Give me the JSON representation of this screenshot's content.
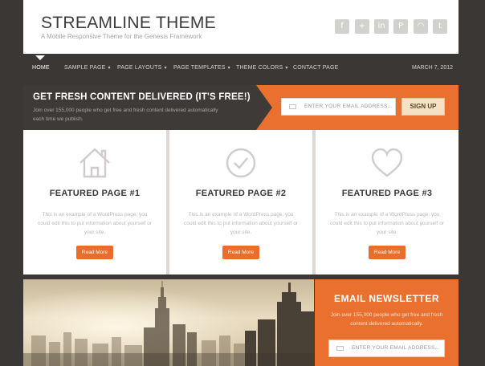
{
  "header": {
    "title": "STREAMLINE THEME",
    "description": "A Mobile Responsive Theme for the Genesis Framework",
    "social_icons": [
      {
        "name": "facebook-icon",
        "glyph": "f"
      },
      {
        "name": "google-plus-icon",
        "glyph": "+"
      },
      {
        "name": "linkedin-icon",
        "glyph": "in"
      },
      {
        "name": "pinterest-icon",
        "glyph": "P"
      },
      {
        "name": "rss-icon",
        "glyph": "◠"
      },
      {
        "name": "twitter-icon",
        "glyph": "t"
      }
    ]
  },
  "nav": {
    "items": [
      {
        "label": "HOME",
        "active": true,
        "dropdown": false
      },
      {
        "label": "SAMPLE PAGE",
        "active": false,
        "dropdown": true
      },
      {
        "label": "PAGE LAYOUTS",
        "active": false,
        "dropdown": true
      },
      {
        "label": "PAGE TEMPLATES",
        "active": false,
        "dropdown": true
      },
      {
        "label": "THEME COLORS",
        "active": false,
        "dropdown": true
      },
      {
        "label": "CONTACT PAGE",
        "active": false,
        "dropdown": false
      }
    ],
    "date": "MARCH 7, 2012"
  },
  "subscribe": {
    "title": "GET FRESH CONTENT DELIVERED (IT'S FREE!)",
    "text": "Join over 155,000 people who get free and fresh content delivered automatically each time we publish.",
    "email_placeholder": "ENTER YOUR EMAIL ADDRESS...",
    "button_label": "SIGN UP"
  },
  "features": [
    {
      "icon": "home-icon",
      "title": "FEATURED PAGE #1",
      "text": "This is an example of a WordPress page, you could edit this to put information about yourself or your site.",
      "button": "Read More"
    },
    {
      "icon": "checkmark-circle-icon",
      "title": "FEATURED PAGE #2",
      "text": "This is an example of a WordPress page, you could edit this to put information about yourself or your site.",
      "button": "Read More"
    },
    {
      "icon": "heart-icon",
      "title": "FEATURED PAGE #3",
      "text": "This is an example of a WordPress page, you could edit this to put information about yourself or your site.",
      "button": "Read More"
    }
  ],
  "newsletter": {
    "title": "EMAIL NEWSLETTER",
    "text": "Join over 155,000 people who get free and fresh content delivered automatically.",
    "email_placeholder": "ENTER YOUR EMAIL ADDRESS..."
  },
  "colors": {
    "accent": "#e9702f",
    "dark": "#3e3a38",
    "button_light": "#f6e1c4"
  }
}
